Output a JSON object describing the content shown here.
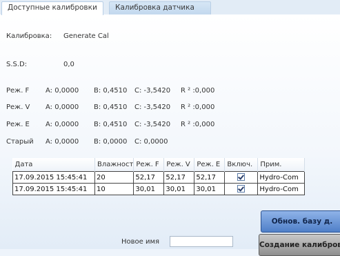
{
  "tabs": [
    {
      "label": "Доступные калибровки",
      "active": true
    },
    {
      "label": "Калибровка датчика",
      "active": false
    }
  ],
  "calibration": {
    "label": "Калибровка:",
    "value": "Generate Cal"
  },
  "ssd": {
    "label": "S.S.D:",
    "value": "0,0"
  },
  "modes": [
    {
      "label": "Реж. F",
      "a": "A: 0,0000",
      "b": "B: 0,4510",
      "c": "C: -3,5420",
      "r": "R ² :0,000"
    },
    {
      "label": "Реж. V",
      "a": "A: 0,0000",
      "b": "B: 0,4510",
      "c": "C: -3,5420",
      "r": "R ² :0,000"
    },
    {
      "label": "Реж. E",
      "a": "A: 0,0000",
      "b": "B: 0,4510",
      "c": "C: -3,5420",
      "r": "R ² :0,000"
    },
    {
      "label": "Старый",
      "a": "A: 0,0000",
      "b": "B: 0,0000",
      "c": "C: 0,0000",
      "r": ""
    }
  ],
  "table": {
    "headers": [
      "Дата",
      "Влажност",
      "Реж. F",
      "Реж. V",
      "Реж. E",
      "Включ.",
      "Прим."
    ],
    "rows": [
      {
        "date": "17.09.2015 15:45:41",
        "moisture": "20",
        "f": "52,17",
        "v": "52,17",
        "e": "52,17",
        "enabled": true,
        "note": "Hydro-Com"
      },
      {
        "date": "17.09.2015 15:45:41",
        "moisture": "10",
        "f": "30,01",
        "v": "30,01",
        "e": "30,01",
        "enabled": true,
        "note": "Hydro-Com"
      }
    ]
  },
  "buttons": {
    "update_db": "Обнов. базу д.",
    "create_calibration": "Создание калибровки"
  },
  "new_name": {
    "label": "Новое имя",
    "value": ""
  },
  "colors": {
    "accent_button": "#5f8fd6",
    "tab_bar": "#e2ecf6",
    "panel_bg": "#ffffff"
  }
}
